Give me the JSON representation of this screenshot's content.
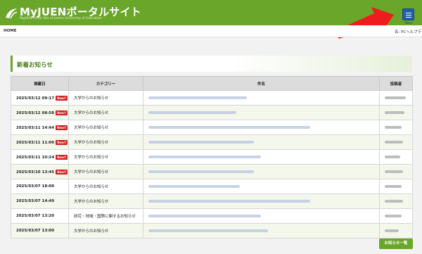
{
  "header": {
    "title": "MyJUENポータルサイト",
    "subtitle": "MyJUEN Portal Site of Joetsu University of Education",
    "menu_caption": "Menu"
  },
  "breadcrumb": {
    "home": "HOME",
    "helpdesk": "名: PCヘルプデスク"
  },
  "section": {
    "title": "新着お知らせ"
  },
  "table": {
    "columns": [
      "掲載日",
      "カテゴリー",
      "件名",
      "投稿者"
    ],
    "rows": [
      {
        "date": "2025/03/12 09:17",
        "new": true,
        "category": "大学からのお知らせ"
      },
      {
        "date": "2025/03/12 08:58",
        "new": true,
        "category": "大学からのお知らせ"
      },
      {
        "date": "2025/03/11 14:44",
        "new": true,
        "category": "大学からのお知らせ"
      },
      {
        "date": "2025/03/11 11:00",
        "new": true,
        "category": "大学からのお知らせ"
      },
      {
        "date": "2025/03/11 10:24",
        "new": true,
        "category": "大学からのお知らせ"
      },
      {
        "date": "2025/03/10 13:45",
        "new": true,
        "category": "大学からのお知らせ"
      },
      {
        "date": "2025/03/07 18:00",
        "new": false,
        "category": "大学からのお知らせ"
      },
      {
        "date": "2025/03/07 14:49",
        "new": false,
        "category": "大学からのお知らせ"
      },
      {
        "date": "2025/03/07 13:20",
        "new": false,
        "category": "研究・地域・国際に関するお知らせ"
      },
      {
        "date": "2025/03/07 13:00",
        "new": false,
        "category": "大学からのお知らせ"
      }
    ],
    "new_label": "New!!"
  },
  "footer": {
    "list_button": "お知らせ一覧"
  },
  "colors": {
    "brand": "#6aa629",
    "menu": "#1f5ea7",
    "badge": "#d01f1f",
    "arrow": "#ee1c1c"
  }
}
